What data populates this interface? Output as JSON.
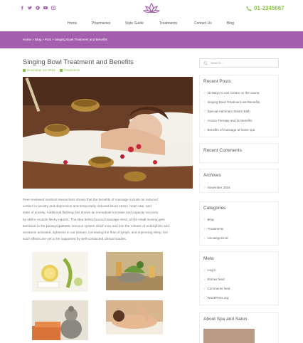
{
  "header": {
    "phone": "01-2345667",
    "nav": [
      "Home",
      "Pharmacies",
      "Style Guide",
      "Treatments",
      "Contact Us",
      "Blog"
    ],
    "social_icons": [
      "facebook-icon",
      "twitter-icon",
      "pinterest-icon",
      "youtube-icon",
      "instagram-icon"
    ],
    "colors": {
      "accent": "#8bc34a",
      "brand": "#a45eae"
    }
  },
  "breadcrumb": "Home  »  Blog  »  Post  »  Singing Bowl Treatment and Benefits",
  "post": {
    "title": "Singing Bowl Treatment and Benefits",
    "date": "November 24, 2016",
    "category": "Treatments",
    "paragraph": [
      "Peer-reviewed medical researchers shown that the benefits of massage include an reduced",
      "cortisol in anxiety and depression and temporarily reduced blood stress. heart rate, and",
      "state of anxiety. Additional flashing has shown an immediate increase and capacity recovery",
      "by skill in muscle fleshy reports. The idea behind sound massage mind: at the small moving gets",
      "technical to the parasympathetic nervous system which now and into the release of endorphins and",
      "serotonin activated, tightness in our tissues, increasing the flow of lymph, and improving sleep, but",
      "such effects are yet to be supported by well-conducted clinical studies."
    ]
  },
  "sidebar": {
    "search_placeholder": "Search...",
    "recent_posts_title": "Recent Posts",
    "recent_posts": [
      "10 Ways to use Cream on the sauna",
      "Singing Bowl Treatment and Benefits",
      "Special Hammam Steam Bath",
      "Aroma Therapy and its Benefits",
      "Benefits of massage at home spa"
    ],
    "recent_comments_title": "Recent Comments",
    "archives_title": "Archives",
    "archives": [
      "November 2016"
    ],
    "categories_title": "Categories",
    "categories": [
      "Blog",
      "Treatments",
      "Uncategorized"
    ],
    "meta_title": "Meta",
    "meta": [
      "Log in",
      "Entries feed",
      "Comments feed",
      "WordPress.org"
    ],
    "about_title": "About Spa and Salon"
  }
}
